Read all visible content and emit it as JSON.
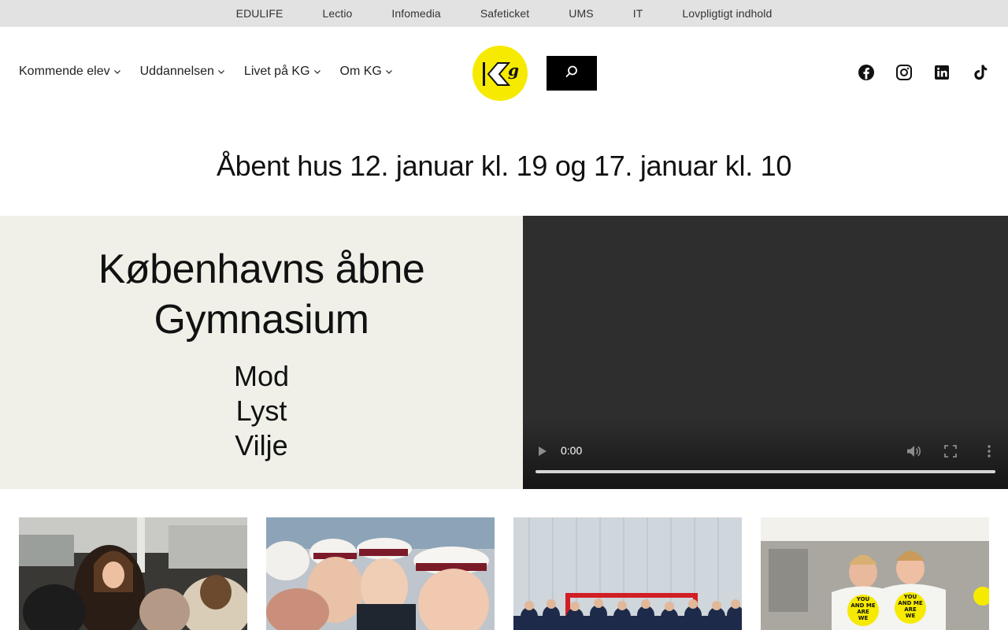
{
  "topbar": {
    "links": [
      "EDULIFE",
      "Lectio",
      "Infomedia",
      "Safeticket",
      "UMS",
      "IT",
      "Lovpligtigt indhold"
    ]
  },
  "nav": {
    "items": [
      "Kommende elev",
      "Uddannelsen",
      "Livet på KG",
      "Om KG"
    ]
  },
  "logo": {
    "icon": "kg-logo",
    "color": "#f6ea00"
  },
  "search": {
    "icon": "search-icon"
  },
  "social": {
    "icons": [
      "facebook-icon",
      "instagram-icon",
      "linkedin-icon",
      "tiktok-icon"
    ]
  },
  "announcement": "Åbent hus 12. januar kl. 19 og 17. januar kl. 10",
  "hero": {
    "title_line1": "Københavns åbne",
    "title_line2": "Gymnasium",
    "words": [
      "Mod",
      "Lyst",
      "Vilje"
    ],
    "background": "#f0f0e9"
  },
  "video": {
    "time": "0:00",
    "controls": [
      "play-icon",
      "volume-icon",
      "fullscreen-icon",
      "more-options-icon"
    ]
  },
  "gallery": {
    "photos": [
      "students-in-hall-photo",
      "graduation-caps-photo",
      "sports-team-photo",
      "tshirt-students-photo"
    ],
    "shirt_text_line1": "YOU",
    "shirt_text_line2": "AND ME",
    "shirt_text_line3": "ARE",
    "shirt_text_line4": "WE"
  },
  "colors": {
    "topbar_bg": "#e2e2e2",
    "accent_yellow": "#f6ea00",
    "video_bg": "#2e2e2e"
  }
}
